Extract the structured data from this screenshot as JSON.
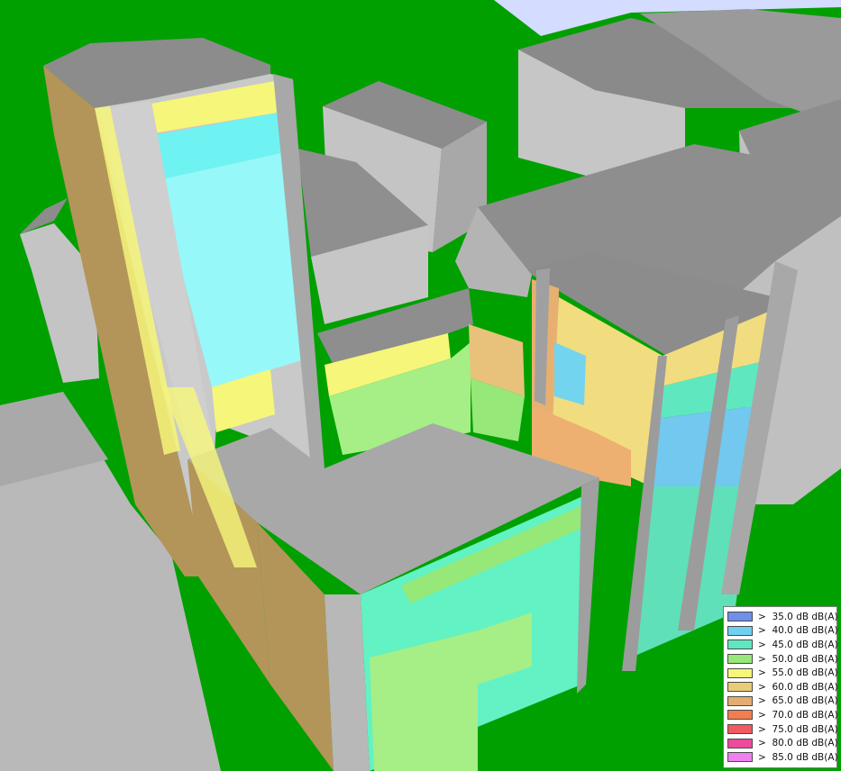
{
  "scene": {
    "colors": {
      "sky": "#d2dcff",
      "ground": "#00a000",
      "roof": "#8c8c8c",
      "wall_light": "#c8c8c8",
      "wall_mid": "#b4b4b4",
      "wall_dark": "#9a9a9a"
    }
  },
  "legend": {
    "items": [
      {
        "label": ">  35.0 dB dB(A)",
        "color": "#6f8fe8"
      },
      {
        "label": ">  40.0 dB dB(A)",
        "color": "#6fd0f0"
      },
      {
        "label": ">  45.0 dB dB(A)",
        "color": "#5fe8c0"
      },
      {
        "label": ">  50.0 dB dB(A)",
        "color": "#96e878"
      },
      {
        "label": ">  55.0 dB dB(A)",
        "color": "#f6f67a"
      },
      {
        "label": ">  60.0 dB dB(A)",
        "color": "#e8cc78"
      },
      {
        "label": ">  65.0 dB dB(A)",
        "color": "#e4ac70"
      },
      {
        "label": ">  70.0 dB dB(A)",
        "color": "#f07e50"
      },
      {
        "label": ">  75.0 dB dB(A)",
        "color": "#f05a60"
      },
      {
        "label": ">  80.0 dB dB(A)",
        "color": "#ee4a9c"
      },
      {
        "label": ">  85.0 dB dB(A)",
        "color": "#f080f0"
      }
    ]
  }
}
